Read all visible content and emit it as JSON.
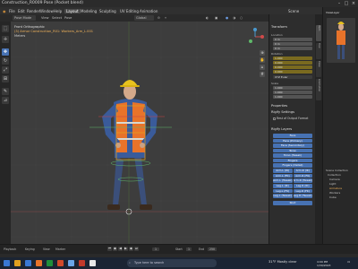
{
  "window": {
    "title": "Construction_R0009 Pose (Pocket blend)"
  },
  "menubar": {
    "items": [
      "File",
      "Edit",
      "Render",
      "Window",
      "Help"
    ],
    "workspace_tabs": [
      "Layout",
      "Modeling",
      "Sculpting",
      "UV Editing",
      "Animation"
    ],
    "active_tab": "Layout",
    "scene": "Scene",
    "view_layer": "ViewLayer"
  },
  "header": {
    "mode": "Pose Mode",
    "view": "View",
    "select": "Select",
    "pose": "Pose",
    "orientation": "Global",
    "pivot": "Local"
  },
  "viewport": {
    "view_name": "Front Orthographic",
    "object_info": "(3) Armor Construction_R01: Workers_Arm_L.001",
    "unit": "Meters"
  },
  "npanel": {
    "transform_title": "Transform",
    "location_label": "Location",
    "location": [
      "0 m",
      "0 m",
      "0 m"
    ],
    "rotation_label": "Rotation",
    "rotation": [
      "1.000",
      "0.000",
      "0.000",
      "0.000"
    ],
    "rotation_mode": "XYZ Euler",
    "scale_label": "Scale",
    "scale": [
      "1.000",
      "1.000",
      "1.000"
    ],
    "properties_title": "Properties",
    "rigify_settings": "Rigify Settings",
    "show_rig_settings": "Rest of Output Format",
    "rigify_layers_title": "Rigify Layers",
    "layers": [
      "Face",
      "Face (Primary)",
      "Face (Secondary)",
      "Torso",
      "Torso (Tweak)",
      "Fingers",
      "Fingers (Detail)",
      "Arm.L (IK)",
      "Arm.R (IK)",
      "Arm.L (FK)",
      "Arm.R (FK)",
      "Arm.L (Tweak)",
      "Arm.R (Tweak)",
      "Leg.L (IK)",
      "Leg.R (IK)",
      "Leg.L (FK)",
      "Leg.R (FK)",
      "Leg.L (Tweak)",
      "Leg.R (Tweak)",
      "Root"
    ]
  },
  "vtabs": [
    "Item",
    "Tool",
    "View",
    "Animation"
  ],
  "rightpanel": {
    "outliner_rows": [
      "Scene Collection",
      "Collection",
      "Camera",
      "Light",
      "Armature",
      "Workers",
      "Cube"
    ],
    "scene_label": "Scene"
  },
  "timeline": {
    "playback": "Playback",
    "keying": "Keying",
    "view": "View",
    "marker": "Marker",
    "current_frame": "1",
    "start_label": "Start",
    "start": "1",
    "end_label": "End",
    "end": "250"
  },
  "taskbar": {
    "search_placeholder": "Type here to search",
    "weather": "31°F  Mostly clear",
    "time": "4:09 PM",
    "date": "1/30/2023",
    "icon_colors": [
      "#ffffff",
      "#3a78d4",
      "#e0a020",
      "#1f8f3a",
      "#d04a2a",
      "#6aa6e8",
      "#c0392b",
      "#e8e8e8"
    ]
  },
  "colors": {
    "accent": "#4772b3",
    "bone_highlight": "#e0a020",
    "vest": "#e8732a"
  }
}
